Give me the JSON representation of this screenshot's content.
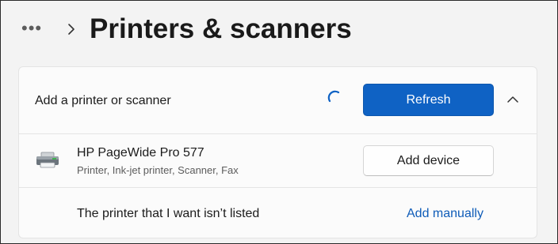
{
  "header": {
    "more_label": "•••",
    "title": "Printers & scanners"
  },
  "add_section": {
    "label": "Add a printer or scanner",
    "refresh_label": "Refresh"
  },
  "device": {
    "name": "HP PageWide Pro 577",
    "description": "Printer, Ink-jet printer, Scanner, Fax",
    "add_label": "Add device"
  },
  "manual": {
    "label": "The printer that I want isn’t listed",
    "link_label": "Add manually"
  },
  "colors": {
    "accent": "#0f62c4",
    "link": "#0f5cb8",
    "background": "#f3f3f3",
    "card": "#fbfbfb"
  },
  "icons": [
    "more-icon",
    "chevron-right-icon",
    "loading-spinner-icon",
    "chevron-up-icon",
    "printer-icon"
  ]
}
